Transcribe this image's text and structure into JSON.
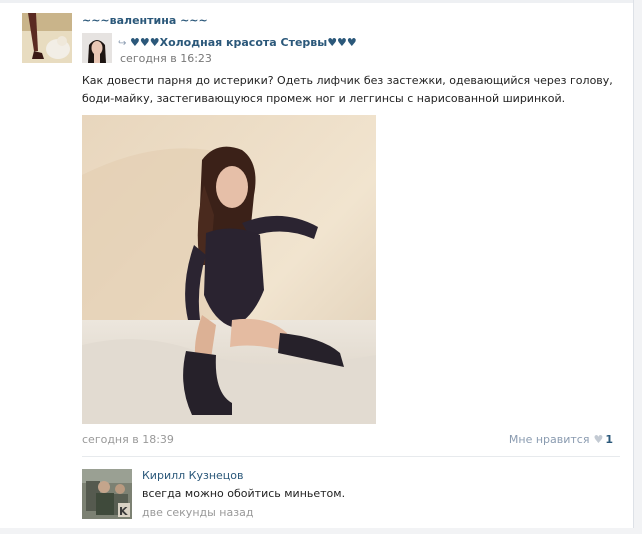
{
  "post": {
    "author": "~~~валентина ~~~",
    "repost_source": "♥♥♥Холодная красота Стервы♥♥♥",
    "repost_time": "сегодня в 16:23",
    "text": "Как довести парня до истерики? Одеть лифчик без застежки, одевающийся через голову, боди-майку, застегивающуюся промеж ног и леггинсы с нарисованной ширинкой.",
    "date": "сегодня в 18:39",
    "like_label": "Мне нравится",
    "like_count": "1"
  },
  "comment": {
    "author": "Кирилл Кузнецов",
    "text": "всегда можно обойтись миньетом.",
    "time": "две секунды назад"
  },
  "icons": {
    "repost": "repost-arrow-icon",
    "like": "heart-icon"
  }
}
